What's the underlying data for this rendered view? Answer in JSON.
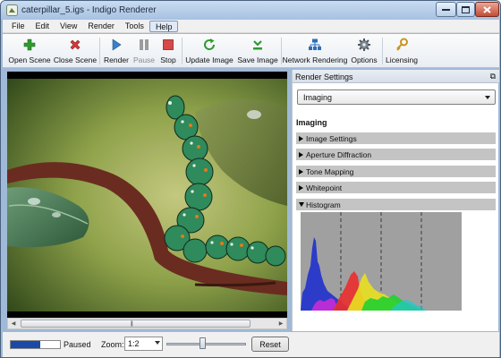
{
  "window": {
    "title": "caterpillar_5.igs - Indigo Renderer"
  },
  "menu": [
    "File",
    "Edit",
    "View",
    "Render",
    "Tools",
    "Help"
  ],
  "toolbar": {
    "open_scene": "Open Scene",
    "close_scene": "Close Scene",
    "render": "Render",
    "pause": "Pause",
    "stop": "Stop",
    "update_image": "Update Image",
    "save_image": "Save Image",
    "network_rendering": "Network Rendering",
    "options": "Options",
    "licensing": "Licensing"
  },
  "status": {
    "progress": 0.6,
    "text": "Paused",
    "zoom_label": "Zoom:",
    "zoom_value": "1:2",
    "zoom_slider": 0.45,
    "reset": "Reset"
  },
  "panel": {
    "title": "Render Settings",
    "mode": "Imaging",
    "heading": "Imaging",
    "sections": [
      {
        "label": "Image Settings",
        "expanded": false
      },
      {
        "label": "Aperture Diffraction",
        "expanded": false
      },
      {
        "label": "Tone Mapping",
        "expanded": false
      },
      {
        "label": "Whitepoint",
        "expanded": false
      },
      {
        "label": "Histogram",
        "expanded": true
      }
    ]
  },
  "colors": {
    "progress": "#1a4aa8",
    "section_bg": "#c4c4c4",
    "histogram_bg": "#a0a0a0"
  }
}
